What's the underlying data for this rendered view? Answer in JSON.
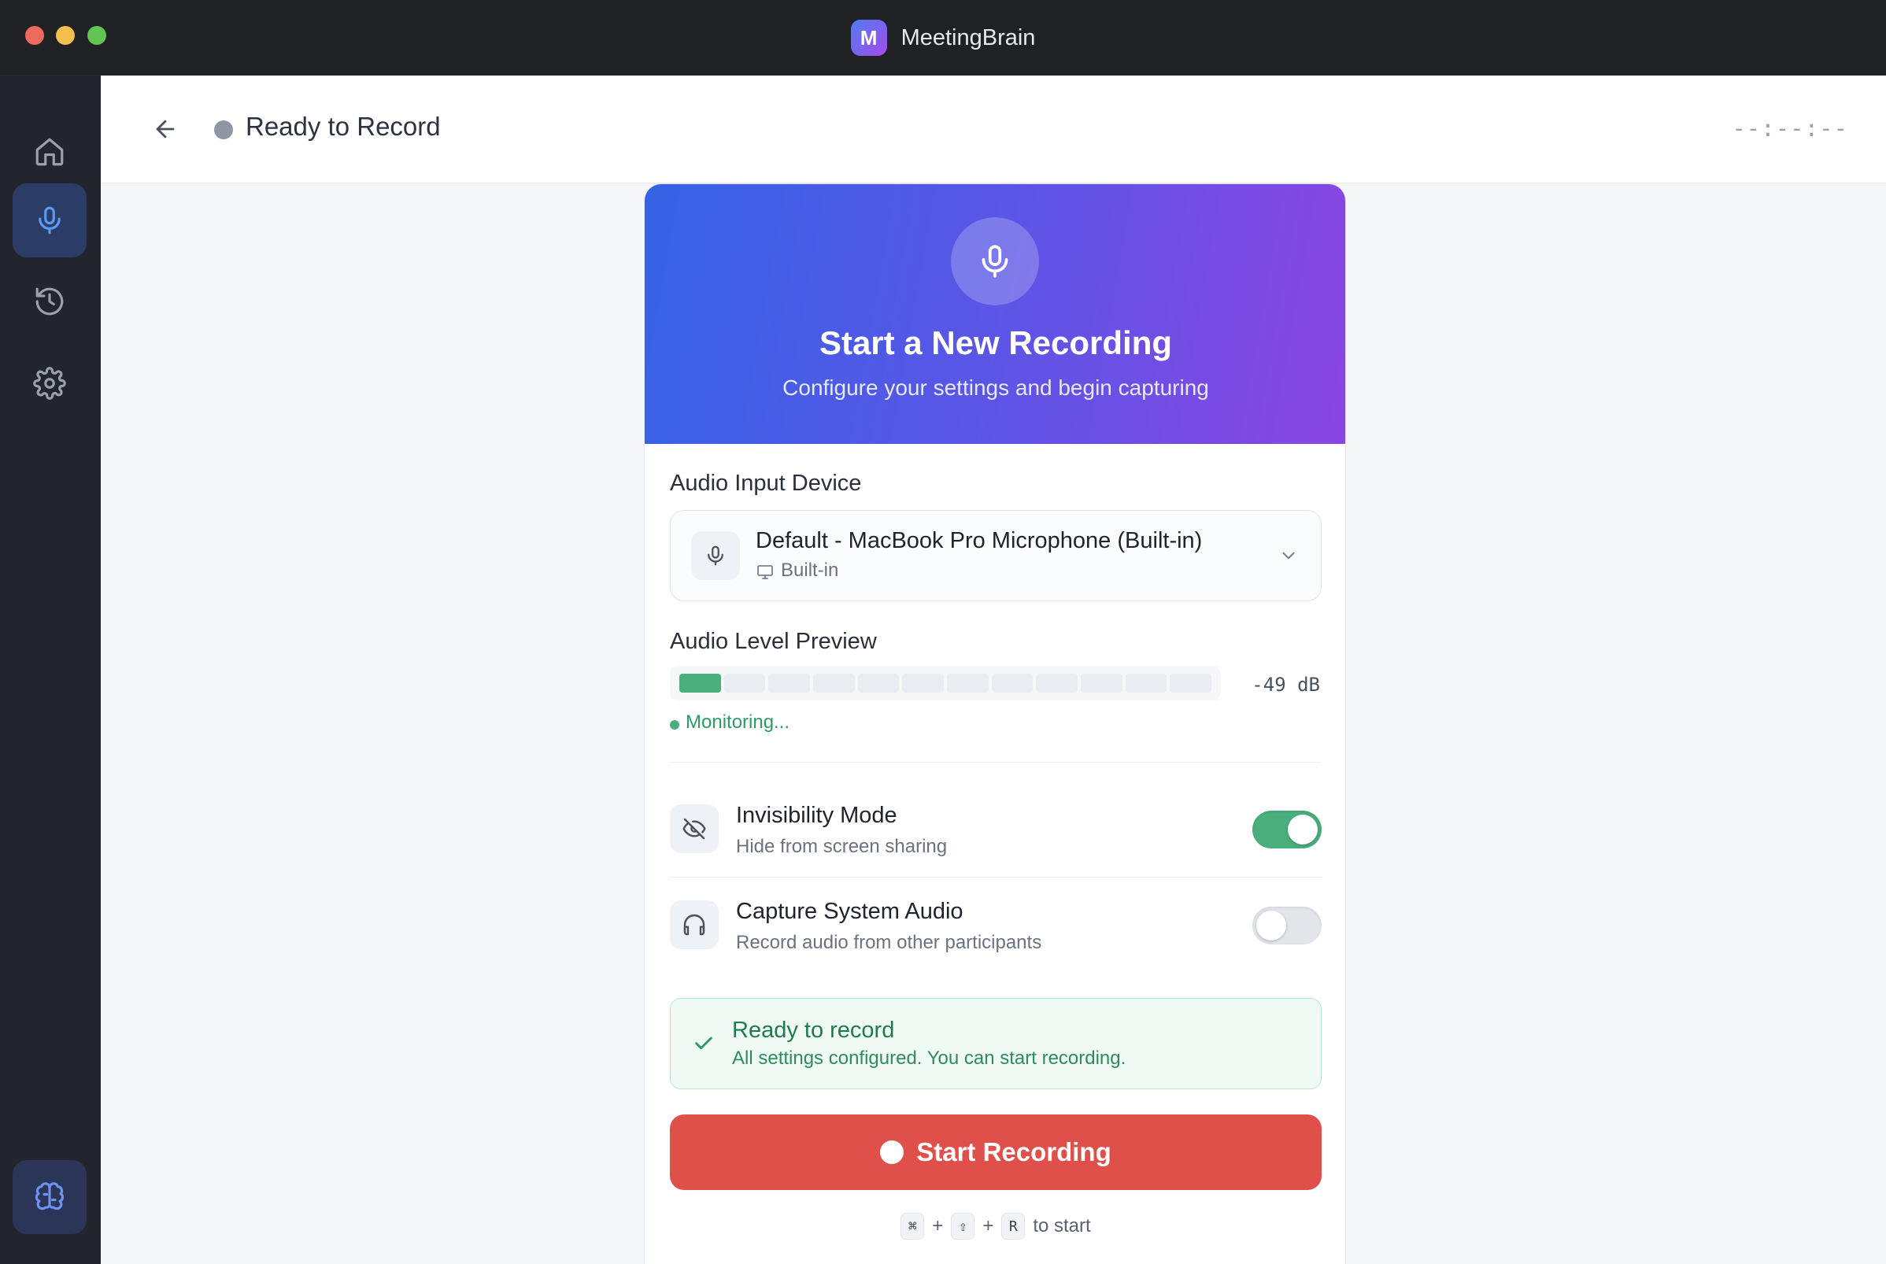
{
  "window": {
    "app_title": "MeetingBrain",
    "app_logo_letter": "M"
  },
  "sidebar": {
    "items": [
      {
        "name": "home",
        "icon": "home-icon",
        "active": false
      },
      {
        "name": "record",
        "icon": "microphone-icon",
        "active": true
      },
      {
        "name": "history",
        "icon": "history-icon",
        "active": false
      },
      {
        "name": "settings",
        "icon": "gear-icon",
        "active": false
      }
    ],
    "bottom_icon": "brain-icon"
  },
  "header": {
    "status": "Ready to Record",
    "timer": "--:--:--"
  },
  "hero": {
    "title": "Start a New Recording",
    "subtitle": "Configure your settings and begin capturing"
  },
  "audio_input": {
    "label": "Audio Input Device",
    "device_name": "Default - MacBook Pro Microphone (Built-in)",
    "device_type": "Built-in"
  },
  "audio_level": {
    "label": "Audio Level Preview",
    "segments_total": 12,
    "segments_active": 1,
    "readout": "-49 dB",
    "status": "Monitoring..."
  },
  "options": {
    "invisibility": {
      "title": "Invisibility Mode",
      "subtitle": "Hide from screen sharing",
      "enabled": true
    },
    "system_audio": {
      "title": "Capture System Audio",
      "subtitle": "Record audio from other participants",
      "enabled": false
    }
  },
  "ready": {
    "title": "Ready to record",
    "message": "All settings configured. You can start recording."
  },
  "start_button": {
    "label": "Start Recording"
  },
  "shortcut": {
    "keys": [
      "⌘",
      "⇧",
      "R"
    ],
    "separator": "+",
    "suffix": "to start"
  },
  "colors": {
    "accent": "#3b82f6",
    "record_red": "#e0504b",
    "success_green": "#4aaf7c",
    "hero_start": "#3563e6",
    "hero_end": "#8a45e2"
  }
}
